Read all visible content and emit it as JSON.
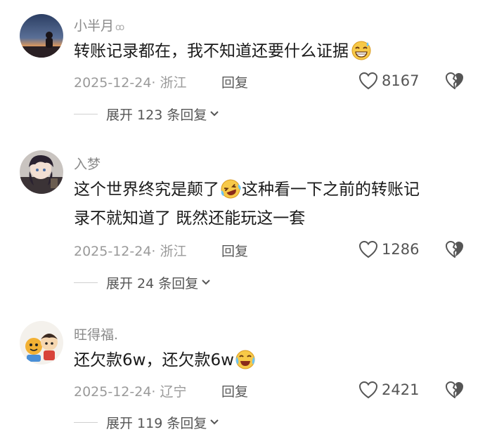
{
  "comments": [
    {
      "username": "小半月",
      "text_lines": [
        "转账记录都在，我不知道还要什么证据"
      ],
      "date": "2025-12-24",
      "location": "浙江",
      "reply_label": "回复",
      "likes": "8167",
      "expand_label": "展开 123 条回复",
      "emoji": "grinning-sweat-emoji"
    },
    {
      "username": "入梦",
      "text_lines": [
        "这个世界终究是颠了",
        "这种看一下之前的转账记",
        "录不就知道了 既然还能玩这一套"
      ],
      "date": "2025-12-24",
      "location": "浙江",
      "reply_label": "回复",
      "likes": "1286",
      "expand_label": "展开 24 条回复",
      "emoji": "laughing-tears-emoji"
    },
    {
      "username": "旺得福.",
      "text_lines": [
        "还欠款6w，还欠款6w"
      ],
      "date": "2025-12-24",
      "location": "辽宁",
      "reply_label": "回复",
      "likes": "2421",
      "expand_label": "展开 119 条回复",
      "emoji": "crying-laugh-emoji"
    }
  ],
  "colors": {
    "username": "#8a8a8a",
    "text": "#1a1a1a",
    "meta": "#9a9a9a",
    "emoji_face": "#f7c948"
  }
}
